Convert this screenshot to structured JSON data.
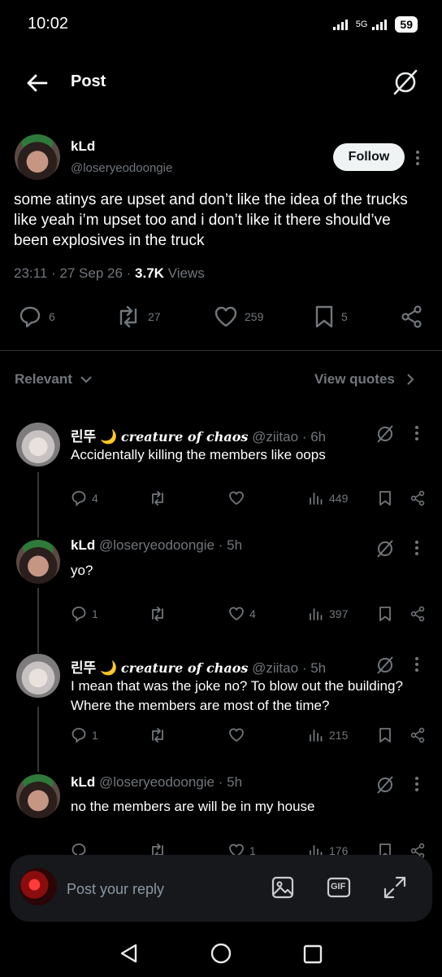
{
  "status_bar": {
    "time": "10:02",
    "network": "5G",
    "battery": "59"
  },
  "header": {
    "title": "Post"
  },
  "main_post": {
    "name": "kLd",
    "handle": "@loseryeodoongie",
    "follow_label": "Follow",
    "text": "some atinys are upset and don’t like the idea of the trucks like yeah i’m upset too and i don’t like it there should’ve been explosives in the truck",
    "time": "23:11",
    "date": "27 Sep 26",
    "views_count": "3.7K",
    "views_label": "Views",
    "replies": "6",
    "reposts": "27",
    "likes": "259",
    "bookmarks": "5"
  },
  "filter": {
    "label": "Relevant",
    "view_quotes": "View quotes"
  },
  "replies": [
    {
      "name": "린뚜",
      "moon": "🌙",
      "title": "creature of chaos",
      "handle": "@ziitao",
      "time": "· 6h",
      "text": "Accidentally killing the members like oops",
      "replies": "4",
      "reposts": "",
      "likes": "",
      "views": "449"
    },
    {
      "name": "kLd",
      "moon": "",
      "title": "",
      "handle": "@loseryeodoongie",
      "time": "· 5h",
      "text": "yo?",
      "replies": "1",
      "reposts": "",
      "likes": "4",
      "views": "397"
    },
    {
      "name": "린뚜",
      "moon": "🌙",
      "title": "creature of chaos",
      "handle": "@ziitao",
      "time": "· 5h",
      "text": "I mean that was the joke no? To blow out the building? Where the members are most of the time?",
      "replies": "1",
      "reposts": "",
      "likes": "",
      "views": "215"
    },
    {
      "name": "kLd",
      "moon": "",
      "title": "",
      "handle": "@loseryeodoongie",
      "time": "· 5h",
      "text": "no the members are will be in my house",
      "replies": "",
      "reposts": "",
      "likes": "1",
      "views": "176"
    }
  ],
  "reply_bar": {
    "placeholder": "Post your reply",
    "gif_label": "GIF"
  },
  "colors": {
    "background": "#000000",
    "muted": "#71767b",
    "text": "#e7e9ea",
    "follow_bg": "#eff3f4"
  }
}
